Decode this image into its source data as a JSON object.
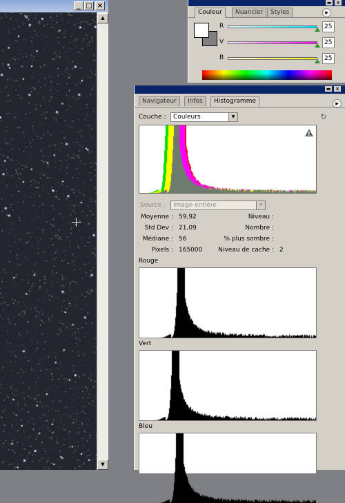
{
  "document": {
    "window_buttons": [
      "_",
      "□",
      "×"
    ],
    "scroll_up": "▲",
    "scroll_down": "▼"
  },
  "color_panel": {
    "tabs": [
      {
        "label": "Couleur",
        "active": true
      },
      {
        "label": "Nuancier",
        "active": false
      },
      {
        "label": "Styles",
        "active": false
      }
    ],
    "sliders": [
      {
        "label": "R",
        "value": "25",
        "gradient": [
          "#ffffff",
          "#00e5ff"
        ]
      },
      {
        "label": "V",
        "value": "25",
        "gradient": [
          "#ffffff",
          "#ff00ff"
        ]
      },
      {
        "label": "B",
        "value": "25",
        "gradient": [
          "#ffffff",
          "#ffff00"
        ]
      }
    ],
    "foreground": "#ffffff",
    "background": "#808080",
    "menu_icon": "menu-arrow-icon"
  },
  "histogram_panel": {
    "tabs": [
      {
        "label": "Navigateur",
        "active": false
      },
      {
        "label": "Infos",
        "active": false
      },
      {
        "label": "Histogramme",
        "active": true
      }
    ],
    "channel_label": "Couche :",
    "channel_value": "Couleurs",
    "source_label": "Source :",
    "source_value": "Image entière",
    "warning_icon": "warning-icon",
    "refresh_icon": "refresh-icon",
    "stats_left": [
      {
        "label": "Moyenne :",
        "value": "59,92"
      },
      {
        "label": "Std Dev :",
        "value": "21,09"
      },
      {
        "label": "Médiane :",
        "value": "56"
      },
      {
        "label": "Pixels :",
        "value": "165000"
      }
    ],
    "stats_right": [
      {
        "label": "Niveau :",
        "value": ""
      },
      {
        "label": "Nombre :",
        "value": ""
      },
      {
        "label": "% plus sombre :",
        "value": ""
      },
      {
        "label": "Niveau de cache :",
        "value": "2"
      }
    ],
    "channels": [
      {
        "label": "Rouge",
        "color": "#000000"
      },
      {
        "label": "Vert",
        "color": "#000000"
      },
      {
        "label": "Bleu",
        "color": "#000000"
      }
    ]
  }
}
